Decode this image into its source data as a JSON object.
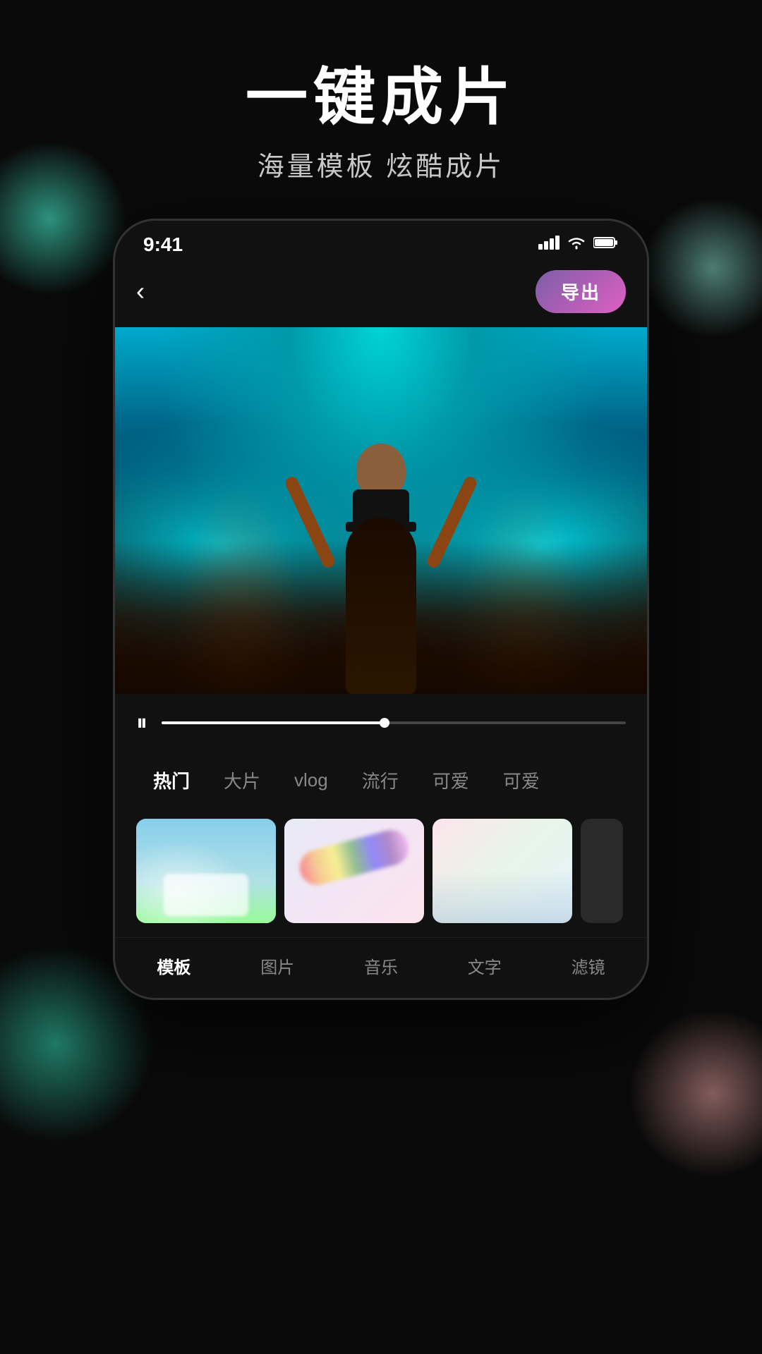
{
  "promo": {
    "title": "一键成片",
    "subtitle": "海量模板  炫酷成片"
  },
  "status_bar": {
    "time": "9:41",
    "signal": "▌▌▌",
    "wifi": "wifi",
    "battery": "🔋"
  },
  "nav": {
    "back_icon": "‹",
    "export_label": "导出"
  },
  "playback": {
    "pause_icon": "⏸",
    "progress_pct": 48
  },
  "categories": [
    {
      "id": "hot",
      "label": "热门",
      "active": true
    },
    {
      "id": "film",
      "label": "大片",
      "active": false
    },
    {
      "id": "vlog",
      "label": "vlog",
      "active": false
    },
    {
      "id": "popular",
      "label": "流行",
      "active": false
    },
    {
      "id": "cute1",
      "label": "可爱",
      "active": false
    },
    {
      "id": "cute2",
      "label": "可爱",
      "active": false
    }
  ],
  "bottom_nav": [
    {
      "id": "template",
      "label": "模板",
      "active": true
    },
    {
      "id": "photo",
      "label": "图片",
      "active": false
    },
    {
      "id": "music",
      "label": "音乐",
      "active": false
    },
    {
      "id": "text",
      "label": "文字",
      "active": false
    },
    {
      "id": "filter",
      "label": "滤镜",
      "active": false
    }
  ]
}
